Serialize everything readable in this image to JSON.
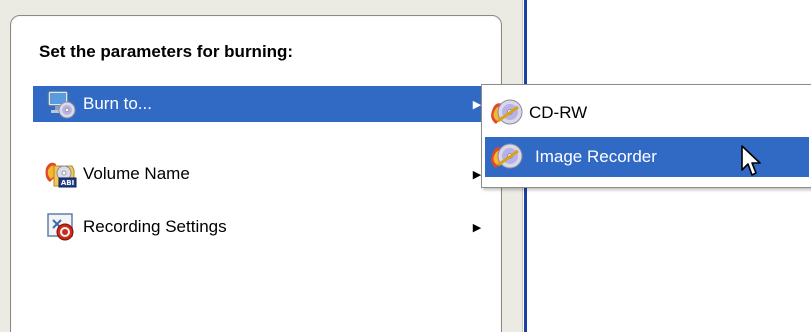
{
  "panel": {
    "title": "Set the parameters for burning:"
  },
  "menu": {
    "items": [
      {
        "label": "Burn to...",
        "icon": "computer-disc-icon",
        "selected": true,
        "has_submenu": true
      },
      {
        "label": "Volume Name",
        "icon": "disc-folder-abi-icon",
        "selected": false,
        "has_submenu": true
      },
      {
        "label": "Recording Settings",
        "icon": "recording-settings-icon",
        "selected": false,
        "has_submenu": true
      }
    ],
    "arrow_glyph": "▶"
  },
  "submenu": {
    "items": [
      {
        "label": "CD-RW",
        "icon": "cd-burn-icon",
        "selected": false
      },
      {
        "label": "Image Recorder",
        "icon": "cd-burn-icon",
        "selected": true
      }
    ]
  },
  "colors": {
    "selection": "#316ac5",
    "accent_rule": "#1c3fa8",
    "panel_bg": "#ffffff",
    "window_bg": "#ecebe3"
  }
}
